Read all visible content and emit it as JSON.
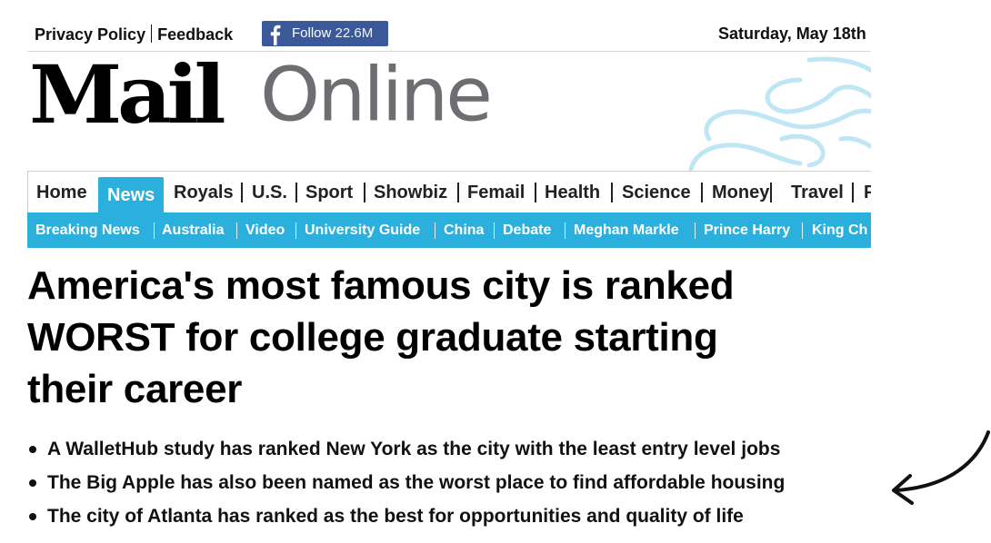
{
  "topbar": {
    "privacy_label": "Privacy Policy",
    "feedback_label": "Feedback",
    "follow_label": "Follow",
    "follow_count": "22.6M",
    "date": "Saturday, May 18th"
  },
  "logo": {
    "mail": "Mail",
    "online": "Online"
  },
  "nav": {
    "items": [
      "Home",
      "News",
      "Royals",
      "U.S.",
      "Sport",
      "Showbiz",
      "Femail",
      "Health",
      "Science",
      "Money",
      "Travel",
      "P"
    ],
    "active": "News"
  },
  "subnav": {
    "items": [
      "Breaking News",
      "Australia",
      "Video",
      "University Guide",
      "China",
      "Debate",
      "Meghan Markle",
      "Prince Harry",
      "King Ch"
    ]
  },
  "article": {
    "headline": "America's most famous city is ranked WORST for college graduate starting their career",
    "bullets": [
      "A WalletHub study has ranked New York as the city with the least entry level jobs",
      "The Big Apple has also been named as the worst place to find affordable housing",
      "The city of Atlanta has ranked as the best for opportunities and quality of life"
    ]
  },
  "colors": {
    "brand_blue": "#2bb0dd",
    "facebook_blue": "#3b5998",
    "online_gray": "#6d6e71",
    "arrow": "#111111"
  }
}
